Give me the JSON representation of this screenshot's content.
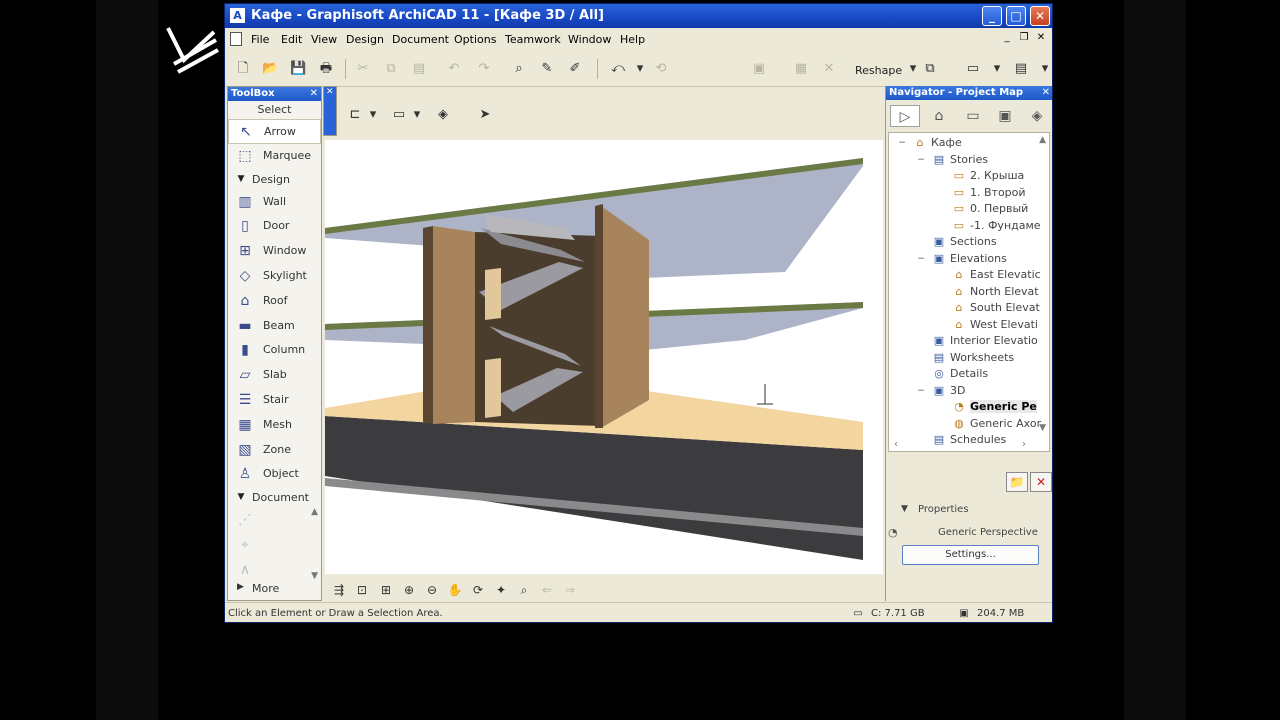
{
  "window": {
    "app_icon": "archicad-logo-icon",
    "title": "Кафе - Graphisoft ArchiCAD 11 - [Кафе 3D / All]",
    "minimize": "_",
    "maximize": "□",
    "close": "✕"
  },
  "menubar": {
    "items": [
      "File",
      "Edit",
      "View",
      "Design",
      "Document",
      "Options",
      "Teamwork",
      "Window",
      "Help"
    ]
  },
  "toolbar": {
    "reshape_label": "Reshape"
  },
  "toolbox": {
    "title": "ToolBox",
    "select_label": "Select",
    "tools": [
      {
        "label": "Arrow",
        "icon": "↖"
      },
      {
        "label": "Marquee",
        "icon": "⬚"
      },
      {
        "label": "Design",
        "icon": "▼"
      },
      {
        "label": "Wall",
        "icon": "▥"
      },
      {
        "label": "Door",
        "icon": "▯"
      },
      {
        "label": "Window",
        "icon": "⊞"
      },
      {
        "label": "Skylight",
        "icon": "◇"
      },
      {
        "label": "Roof",
        "icon": "⌂"
      },
      {
        "label": "Beam",
        "icon": "▬"
      },
      {
        "label": "Column",
        "icon": "▮"
      },
      {
        "label": "Slab",
        "icon": "▱"
      },
      {
        "label": "Stair",
        "icon": "☰"
      },
      {
        "label": "Mesh",
        "icon": "▦"
      },
      {
        "label": "Zone",
        "icon": "▧"
      },
      {
        "label": "Object",
        "icon": "♙"
      },
      {
        "label": "Document",
        "icon": "▼"
      }
    ],
    "more_label": "More"
  },
  "navigator": {
    "title": "Navigator - Project Map",
    "tree": [
      {
        "label": "Кафе",
        "icon": "⌂"
      },
      {
        "label": "Stories",
        "icon": "▤"
      },
      {
        "label": "2. Крыша",
        "icon": "▭"
      },
      {
        "label": "1. Второй",
        "icon": "▭"
      },
      {
        "label": "0. Первый",
        "icon": "▭"
      },
      {
        "label": "-1. Фундаме",
        "icon": "▭"
      },
      {
        "label": "Sections",
        "icon": "▣"
      },
      {
        "label": "Elevations",
        "icon": "▣"
      },
      {
        "label": "East Elevatic",
        "icon": "⌂"
      },
      {
        "label": "North Elevat",
        "icon": "⌂"
      },
      {
        "label": "South Elevat",
        "icon": "⌂"
      },
      {
        "label": "West Elevati",
        "icon": "⌂"
      },
      {
        "label": "Interior Elevatio",
        "icon": "▣"
      },
      {
        "label": "Worksheets",
        "icon": "▤"
      },
      {
        "label": "Details",
        "icon": "◎"
      },
      {
        "label": "3D",
        "icon": "▣"
      },
      {
        "label": "Generic Pe",
        "icon": "◔"
      },
      {
        "label": "Generic Axor",
        "icon": "◍"
      },
      {
        "label": "Schedules",
        "icon": "▤"
      }
    ],
    "properties_label": "Properties",
    "view_name": "Generic Perspective",
    "settings_button": "Settings..."
  },
  "status": {
    "message": "Click an Element or Draw a Selection Area.",
    "disk": "C: 7.71 GB",
    "memory": "204.7 MB"
  },
  "colors": {
    "titlebar": "#1848c4",
    "floor": "#f3d5a0",
    "slab_green": "#6b7a45",
    "wall_brown": "#a8845c",
    "ceiling_blue": "#aeb4c8",
    "ground_dark": "#3c3c3e"
  }
}
